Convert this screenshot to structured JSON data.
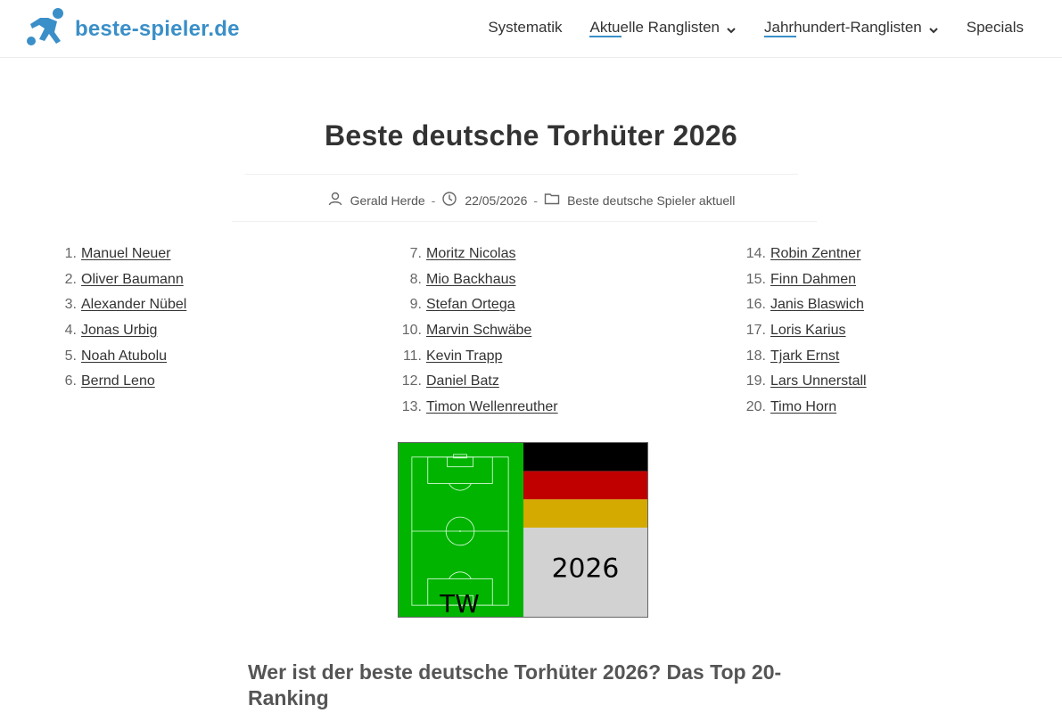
{
  "site": {
    "brand": "beste-spieler.de",
    "accent_color": "#3a8fc8",
    "logo_icon": "soccer-player-icon"
  },
  "nav": {
    "items": [
      {
        "label": "Systematik",
        "has_dropdown": false,
        "active": false
      },
      {
        "label": "Aktuelle Ranglisten",
        "has_dropdown": true,
        "active": true
      },
      {
        "label": "Jahrhundert-Ranglisten",
        "has_dropdown": true,
        "active": true
      },
      {
        "label": "Specials",
        "has_dropdown": false,
        "active": false
      }
    ]
  },
  "article": {
    "title": "Beste deutsche Torhüter 2026",
    "meta": {
      "author": "Gerald Herde",
      "date": "22/05/2026",
      "category": "Beste deutsche Spieler aktuell",
      "separator": "-"
    },
    "ranking": [
      {
        "num": "1.",
        "name": "Manuel Neuer"
      },
      {
        "num": "2.",
        "name": "Oliver Baumann"
      },
      {
        "num": "3.",
        "name": "Alexander Nübel"
      },
      {
        "num": "4.",
        "name": "Jonas Urbig"
      },
      {
        "num": "5.",
        "name": "Noah Atubolu"
      },
      {
        "num": "6.",
        "name": "Bernd Leno"
      },
      {
        "num": "7.",
        "name": "Moritz Nicolas"
      },
      {
        "num": "8.",
        "name": "Mio Backhaus"
      },
      {
        "num": "9.",
        "name": "Stefan Ortega"
      },
      {
        "num": "10.",
        "name": "Marvin Schwäbe"
      },
      {
        "num": "11.",
        "name": "Kevin Trapp"
      },
      {
        "num": "12.",
        "name": "Daniel Batz"
      },
      {
        "num": "13.",
        "name": "Timon Wellenreuther"
      },
      {
        "num": "14.",
        "name": "Robin Zentner"
      },
      {
        "num": "15.",
        "name": "Finn Dahmen"
      },
      {
        "num": "16.",
        "name": "Janis Blaswich"
      },
      {
        "num": "17.",
        "name": "Loris Karius"
      },
      {
        "num": "18.",
        "name": "Tjark Ernst"
      },
      {
        "num": "19.",
        "name": "Lars Unnerstall"
      },
      {
        "num": "20.",
        "name": "Timo Horn"
      }
    ],
    "hero_image": {
      "position_label": "TW",
      "year": "2026",
      "pitch_color": "#00b400",
      "flag_colors": [
        "#000000",
        "#dd0000",
        "#ffcc00"
      ],
      "panel_color": "#d2d2d2"
    },
    "section_heading": "Wer ist der beste deutsche Torhüter 2026? Das Top 20-Ranking"
  }
}
